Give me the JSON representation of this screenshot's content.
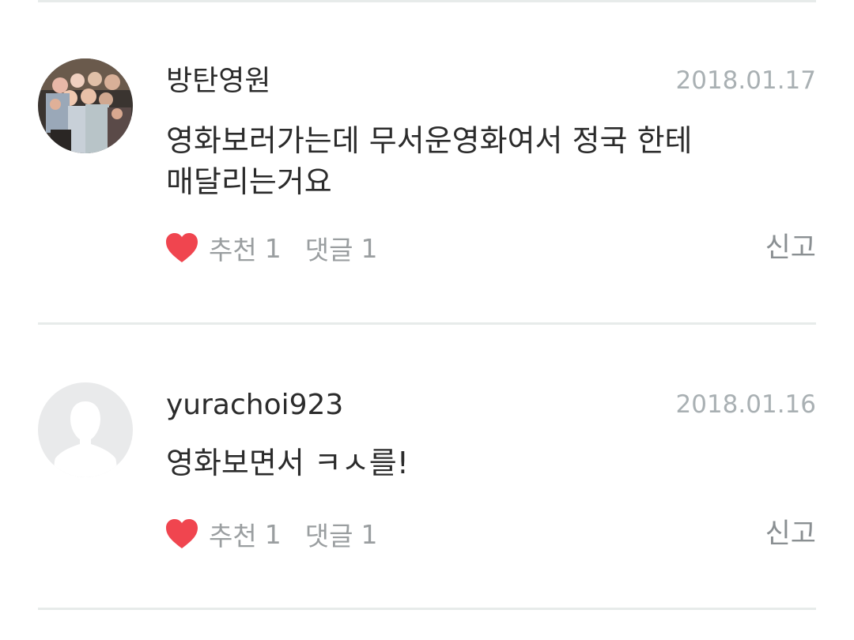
{
  "comments": [
    {
      "username": "방탄영원",
      "date": "2018.01.17",
      "text": "영화보러가는데 무서운영화여서 정국 한테 매달리는거요",
      "like_label": "추천",
      "like_count": "1",
      "reply_label": "댓글",
      "reply_count": "1",
      "report_label": "신고",
      "avatar": "group-photo"
    },
    {
      "username": "yurachoi923",
      "date": "2018.01.16",
      "text": "영화보면서 ㅋㅅ를!",
      "like_label": "추천",
      "like_count": "1",
      "reply_label": "댓글",
      "reply_count": "1",
      "report_label": "신고",
      "avatar": "default-user-icon"
    }
  ],
  "colors": {
    "heart": "#f0454f",
    "divider": "#e7ebea",
    "date": "#a9b0b3",
    "text": "#2b2b2b",
    "meta": "#9a9ea0"
  }
}
